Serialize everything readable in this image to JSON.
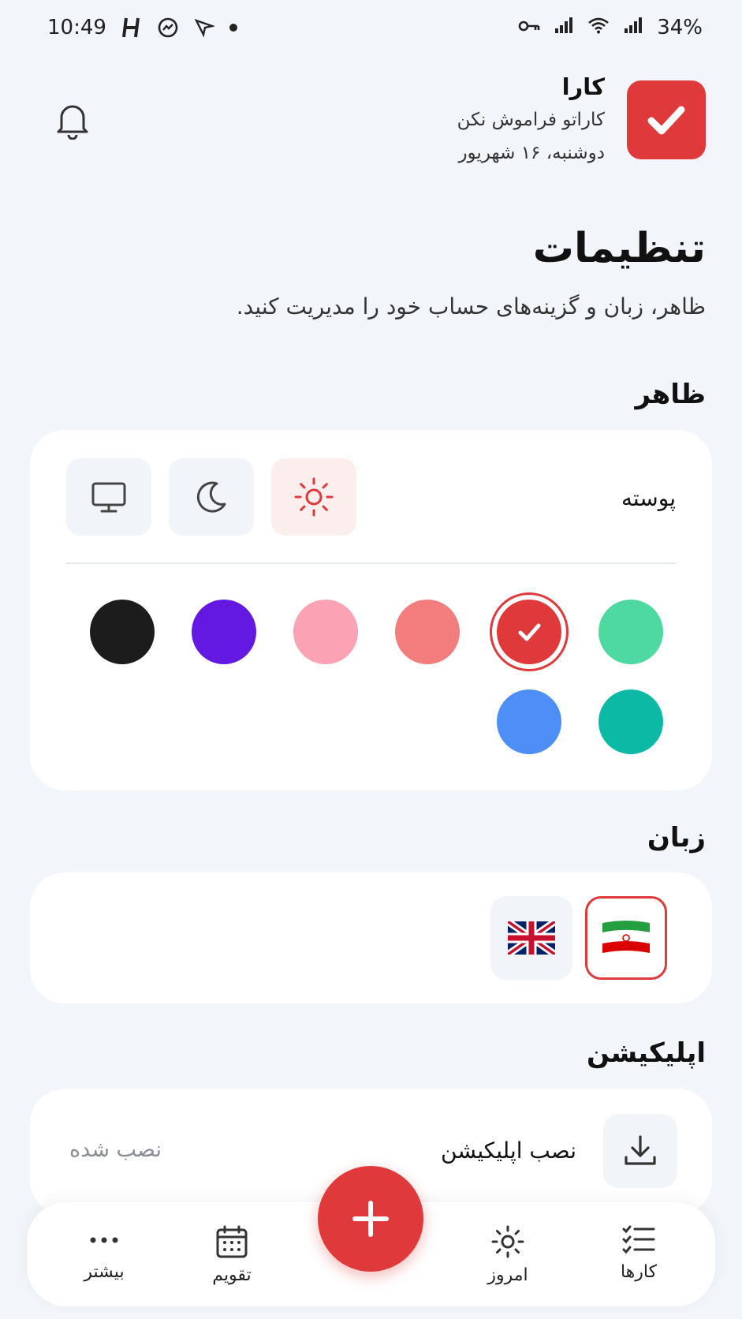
{
  "status_bar": {
    "time": "10:49",
    "battery": "34%",
    "icons": [
      "h-app-icon",
      "messenger-icon",
      "nav-app-icon",
      "dot-icon",
      "vpn-key-icon",
      "signal-icon",
      "wifi-icon",
      "signal-icon",
      "battery-text"
    ]
  },
  "header": {
    "app_name": "کارا",
    "tagline": "کاراتو فراموش نکن",
    "date": "دوشنبه، ۱۶ شهریور",
    "logo_color": "#e0393b"
  },
  "page": {
    "title": "تنظیمات",
    "subtitle": "ظاهر، زبان و گزینه‌های حساب خود را مدیریت کنید."
  },
  "appearance": {
    "section_title": "ظاهر",
    "theme_label": "پوسته",
    "theme_options": [
      {
        "icon": "sun-icon",
        "selected": true
      },
      {
        "icon": "moon-icon",
        "selected": false
      },
      {
        "icon": "monitor-icon",
        "selected": false
      }
    ],
    "accent_colors": [
      {
        "color": "#4dd9a0",
        "selected": false
      },
      {
        "color": "#e0393b",
        "selected": true
      },
      {
        "color": "#f37d7d",
        "selected": false
      },
      {
        "color": "#fba3b5",
        "selected": false
      },
      {
        "color": "#6319e2",
        "selected": false
      },
      {
        "color": "#1c1c1c",
        "selected": false
      },
      {
        "color": "#0bb9a5",
        "selected": false
      },
      {
        "color": "#4d8ff7",
        "selected": false
      }
    ]
  },
  "language": {
    "section_title": "زبان",
    "options": [
      {
        "icon": "iran-flag-icon",
        "selected": true
      },
      {
        "icon": "uk-flag-icon",
        "selected": false
      }
    ]
  },
  "application": {
    "section_title": "اپلیکیشن",
    "install_label": "نصب اپلیکیشن",
    "install_status": "نصب شده"
  },
  "bottom_nav": {
    "tasks": "کارها",
    "today": "امروز",
    "calendar": "تقویم",
    "more": "بیشتر"
  }
}
